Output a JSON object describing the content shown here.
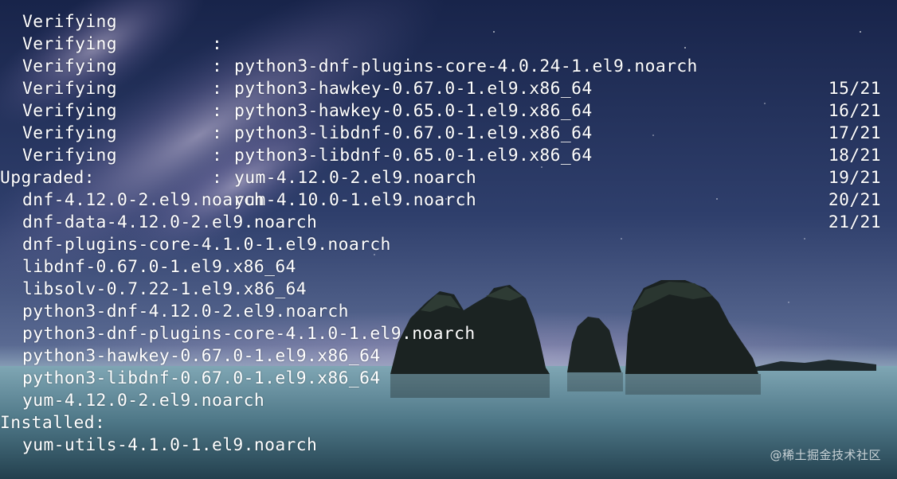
{
  "terminal": {
    "verifying": [
      {
        "action": "Verifying",
        "sep": ":",
        "package": "python3-dnf-plugins-core-4.0.24-1.el9.noarch",
        "count": "15/21"
      },
      {
        "action": "Verifying",
        "sep": ":",
        "package": "python3-hawkey-0.67.0-1.el9.x86_64",
        "count": "16/21"
      },
      {
        "action": "Verifying",
        "sep": ":",
        "package": "python3-hawkey-0.65.0-1.el9.x86_64",
        "count": "17/21"
      },
      {
        "action": "Verifying",
        "sep": ":",
        "package": "python3-libdnf-0.67.0-1.el9.x86_64",
        "count": "18/21"
      },
      {
        "action": "Verifying",
        "sep": ":",
        "package": "python3-libdnf-0.65.0-1.el9.x86_64",
        "count": "19/21"
      },
      {
        "action": "Verifying",
        "sep": ":",
        "package": "yum-4.12.0-2.el9.noarch",
        "count": "20/21"
      },
      {
        "action": "Verifying",
        "sep": ":",
        "package": "yum-4.10.0-1.el9.noarch",
        "count": "21/21"
      }
    ],
    "upgraded_heading": "Upgraded:",
    "upgraded": [
      "dnf-4.12.0-2.el9.noarch",
      "dnf-data-4.12.0-2.el9.noarch",
      "dnf-plugins-core-4.1.0-1.el9.noarch",
      "libdnf-0.67.0-1.el9.x86_64",
      "libsolv-0.7.22-1.el9.x86_64",
      "python3-dnf-4.12.0-2.el9.noarch",
      "python3-dnf-plugins-core-4.1.0-1.el9.noarch",
      "python3-hawkey-0.67.0-1.el9.x86_64",
      "python3-libdnf-0.67.0-1.el9.x86_64",
      "yum-4.12.0-2.el9.noarch"
    ],
    "installed_heading": "Installed:",
    "installed": [
      "yum-utils-4.1.0-1.el9.noarch"
    ]
  },
  "watermark": "@稀土掘金技术社区",
  "colors": {
    "text": "#ffffff",
    "sky_top": "#1c2a52",
    "sky_mid": "#3a4a78",
    "sea": "#5f8a9a",
    "rock": "#1e2626"
  }
}
